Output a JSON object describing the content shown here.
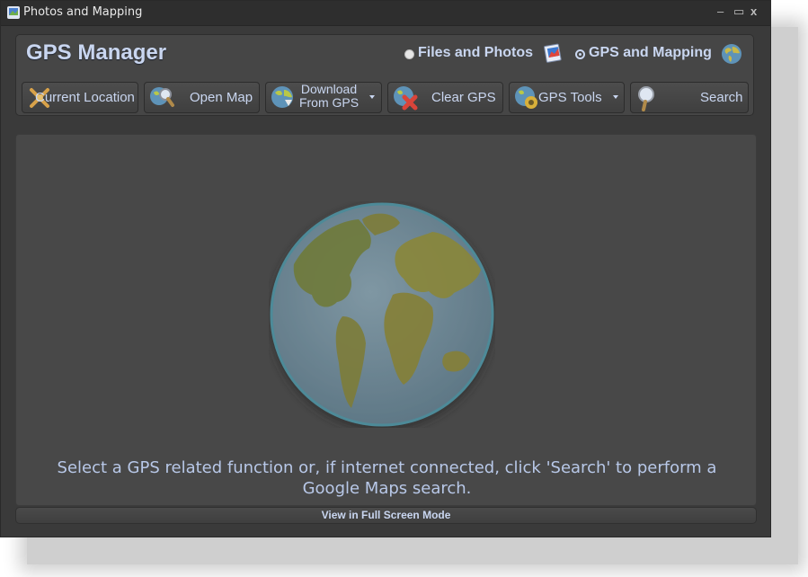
{
  "window": {
    "title": "Photos and Mapping",
    "controls": {
      "minimize": "–",
      "maximize": "▭",
      "close": "x"
    }
  },
  "header": {
    "app_title": "GPS Manager",
    "modes": [
      {
        "label": "Files and Photos",
        "selected": false,
        "icon": "photos-icon"
      },
      {
        "label": "GPS and Mapping",
        "selected": true,
        "icon": "globe-icon"
      }
    ]
  },
  "toolbar": {
    "buttons": [
      {
        "label": "Current Location",
        "icon": "location-crosshair-icon",
        "dropdown": false
      },
      {
        "label": "Open Map",
        "icon": "map-magnifier-icon",
        "dropdown": false
      },
      {
        "label_line1": "Download",
        "label_line2": "From GPS",
        "icon": "download-globe-icon",
        "dropdown": true
      },
      {
        "label": "Clear GPS",
        "icon": "clear-gps-icon",
        "dropdown": false
      },
      {
        "label": "GPS Tools",
        "icon": "gps-tools-icon",
        "dropdown": true
      },
      {
        "label": "Search",
        "icon": "magnifier-icon",
        "dropdown": false
      }
    ]
  },
  "main": {
    "illustration": "world-globe",
    "message": "Select a GPS related function or, if internet connected, click 'Search' to perform a Google Maps search."
  },
  "footer": {
    "fullscreen_label": "View in Full Screen Mode"
  },
  "colors": {
    "accent_text": "#c9d6f0",
    "window_bg": "#3a3a3a",
    "panel_bg": "#484848",
    "globe_ocean": "#6f8a98",
    "globe_land": "#8a8a3a"
  }
}
